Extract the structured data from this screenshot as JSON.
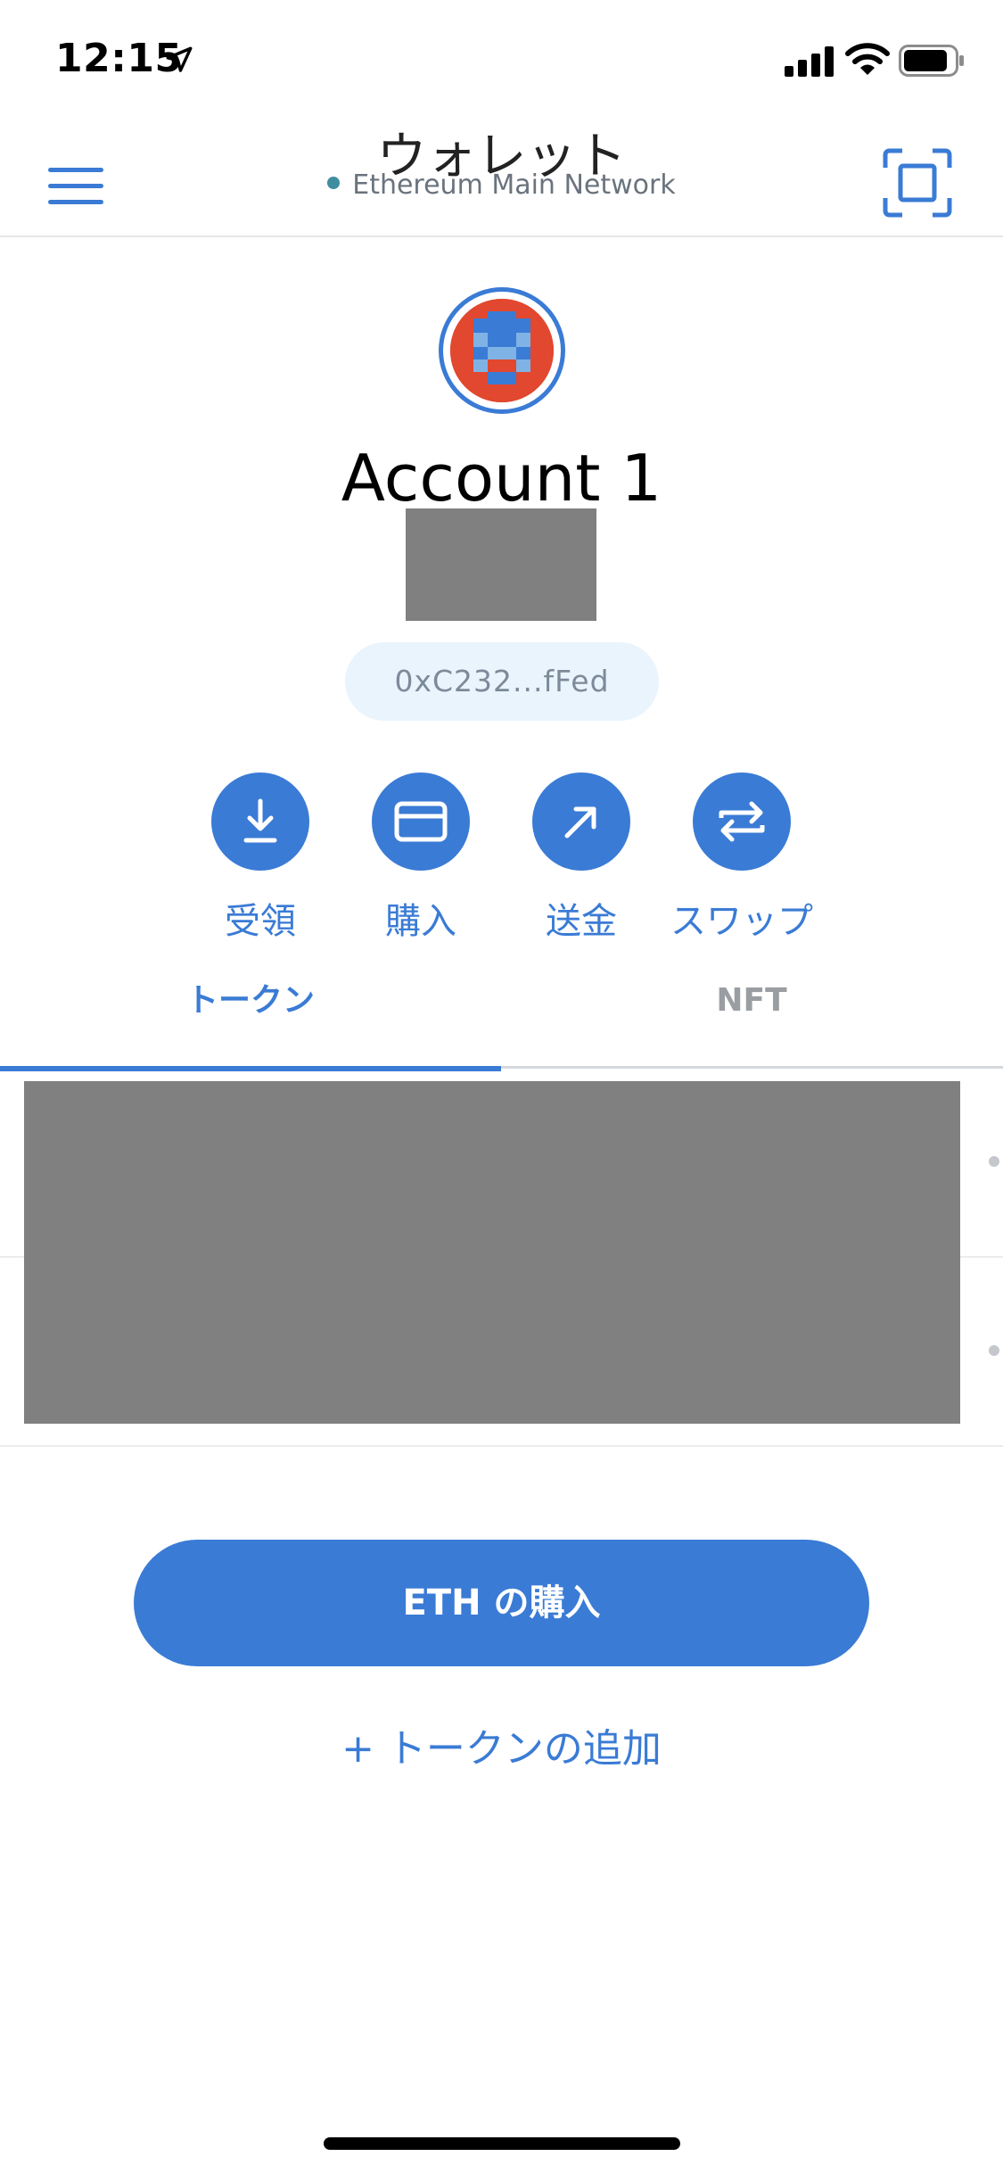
{
  "status_bar": {
    "time": "12:15"
  },
  "header": {
    "title": "ウォレット",
    "network": "Ethereum Main Network",
    "network_dot_color": "#3f8ea0"
  },
  "account": {
    "name": "Account 1",
    "address": "0xC232...fFed"
  },
  "actions": [
    {
      "label": "受領",
      "icon": "download-icon"
    },
    {
      "label": "購入",
      "icon": "card-icon"
    },
    {
      "label": "送金",
      "icon": "arrow-up-right-icon"
    },
    {
      "label": "スワップ",
      "icon": "swap-icon"
    }
  ],
  "tabs": {
    "tokens": "トークン",
    "nft": "NFT",
    "active": "tokens"
  },
  "buy_eth_label": "ETH の購入",
  "add_token_label": "+ トークンの追加",
  "colors": {
    "accent": "#3a7bd5",
    "avatar_red": "#e2472f",
    "pill_bg": "#eaf4fd"
  }
}
